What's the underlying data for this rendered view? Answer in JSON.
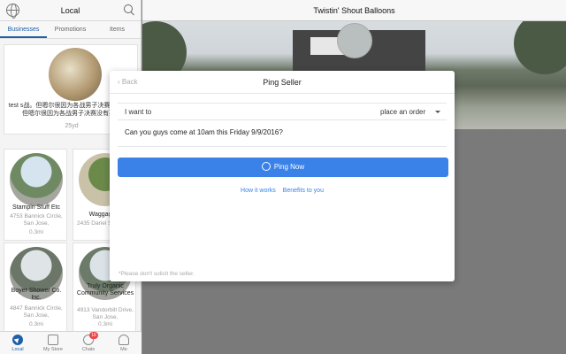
{
  "sidebar": {
    "title": "Local",
    "tabs": [
      {
        "label": "Businesses"
      },
      {
        "label": "Promotions"
      },
      {
        "label": "Items"
      }
    ],
    "featured": {
      "description": "test s战。但嗯尔很因为各战男子决赛没有亮相 但嗯尔很因为各战男子决赛没有亮相",
      "distance": "25yd"
    },
    "cards": [
      {
        "name": "Stampin Stuff Etc",
        "address": "4753 Bannick Circle, San Jose,",
        "distance": "0.3mi"
      },
      {
        "name": "Waggage D",
        "address": "2435 Dariel San Jose,",
        "distance": ""
      },
      {
        "name": "Boyer Shower Co. Inc.",
        "address": "4847 Bannick Circle, San Jose,",
        "distance": "0.3mi"
      },
      {
        "name": "Truly Organic Community Services",
        "address": "4913 Vandorbilt Drive, San Jose,",
        "distance": "0.3mi"
      }
    ],
    "bottom_nav": [
      {
        "label": "Local",
        "icon": "compass-icon"
      },
      {
        "label": "My Store",
        "icon": "store-icon"
      },
      {
        "label": "Chats",
        "icon": "chat-icon",
        "badge": "16"
      },
      {
        "label": "Me",
        "icon": "person-icon"
      }
    ]
  },
  "main": {
    "title": "Twistin' Shout Balloons"
  },
  "modal": {
    "back_label": "Back",
    "title": "Ping Seller",
    "intent_label": "I want to",
    "intent_value": "place an order",
    "message": "Can you guys come at 10am this Friday 9/9/2016?",
    "button_label": "Ping Now",
    "link_how": "How it works",
    "link_benefits": "Benefits to you",
    "note": "*Please don't solicit the seller."
  },
  "colors": {
    "accent": "#3a82e8",
    "nav_active": "#1f5fa8",
    "badge": "#ee4444"
  }
}
